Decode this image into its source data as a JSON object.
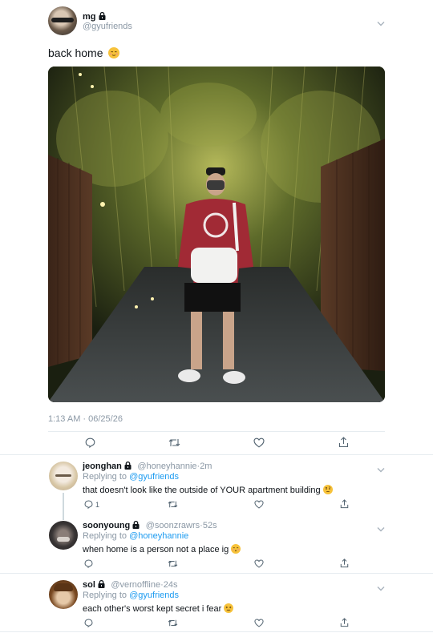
{
  "tweet": {
    "display_name": "mg",
    "handle": "@gyufriends",
    "text": "back home",
    "text_emoji": "relieved-face-emoji",
    "timestamp": "1:13 AM · 06/25/26",
    "photo_description_icon": "photo"
  },
  "replies": [
    {
      "display_name": "jeonghan",
      "handle": "@honeyhannie",
      "time": "2m",
      "replying_prefix": "Replying to",
      "replying_to": "@gyufriends",
      "text": "that doesn't look like the outside of YOUR apartment building",
      "emoji": "face-with-raised-eyebrow-emoji",
      "reply_count": "1"
    },
    {
      "display_name": "soonyoung",
      "handle": "@soonzrawrs",
      "time": "52s",
      "replying_prefix": "Replying to",
      "replying_to": "@honeyhannie",
      "text": "when home is a person not a place ig",
      "emoji": "blushing-face-emoji",
      "reply_count": ""
    },
    {
      "display_name": "sol",
      "handle": "@vernoffline",
      "time": "24s",
      "replying_prefix": "Replying to",
      "replying_to": "@gyufriends",
      "text": "each other's worst kept secret i fear",
      "emoji": "confounded-face-emoji",
      "reply_count": ""
    }
  ],
  "colors": {
    "accent": "#1d9bf0",
    "secondary_text": "#8b98a5",
    "divider": "#e6ecf0"
  }
}
